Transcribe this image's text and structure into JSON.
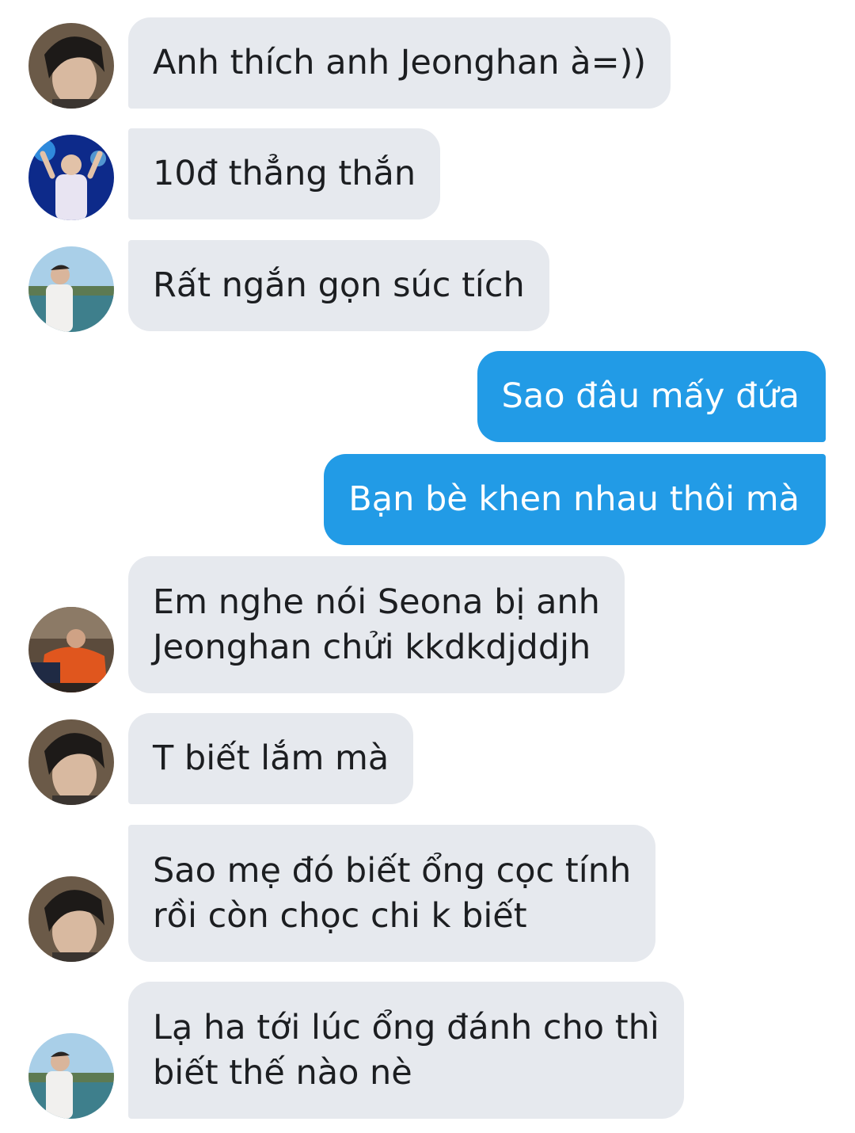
{
  "messages": [
    {
      "sender": "them",
      "avatar": "dark-hair-selfie-avatar",
      "text": "Anh thích anh Jeonghan à=))"
    },
    {
      "sender": "them",
      "avatar": "concert-stage-avatar",
      "text": "10đ thẳng thắn"
    },
    {
      "sender": "them",
      "avatar": "seaside-photo-avatar",
      "text": "Rất ngắn gọn súc tích"
    },
    {
      "sender": "me",
      "text": "Sao đâu mấy đứa"
    },
    {
      "sender": "me",
      "text": "Bạn bè khen nhau thôi mà"
    },
    {
      "sender": "them",
      "avatar": "orange-shirt-avatar",
      "lines": [
        "Em nghe nói Seona bị anh",
        "Jeonghan chửi kkdkdjddjh"
      ]
    },
    {
      "sender": "them",
      "avatar": "dark-hair-selfie-avatar",
      "text": "T biết lắm mà"
    },
    {
      "sender": "them",
      "avatar": "dark-hair-selfie-avatar",
      "lines": [
        "Sao mẹ đó biết ổng cọc tính",
        "rồi còn chọc chi k biết"
      ]
    },
    {
      "sender": "them",
      "avatar": "seaside-photo-avatar",
      "lines": [
        "Lạ ha tới lúc ổng đánh cho thì",
        "biết thế nào nè"
      ]
    }
  ],
  "colors": {
    "incoming_bubble": "#e6e9ee",
    "outgoing_bubble": "#229be6",
    "incoming_text": "#1c1e21",
    "outgoing_text": "#ffffff"
  }
}
